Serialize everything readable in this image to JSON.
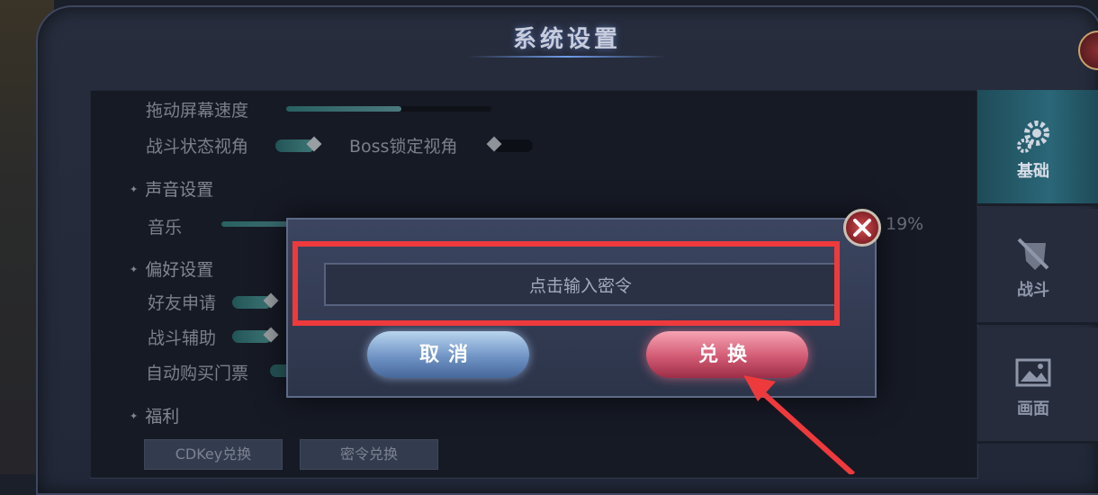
{
  "panel": {
    "title": "系统设置"
  },
  "settings": {
    "drag_speed_label": "拖动屏幕速度",
    "battle_view_label": "战斗状态视角",
    "boss_lock_label": "Boss锁定视角",
    "sound_section": "声音设置",
    "music_label": "音乐",
    "music_value": "19%",
    "music_level": 0.19,
    "pref_section": "偏好设置",
    "friend_request_label": "好友申请",
    "battle_assist_label": "战斗辅助",
    "auto_ticket_label": "自动购买门票",
    "welfare_section": "福利",
    "cdkey_button": "CDKey兑换",
    "password_button": "密令兑换"
  },
  "side_tabs": [
    {
      "label": "基础",
      "icon": "gear-icon",
      "active": true
    },
    {
      "label": "战斗",
      "icon": "sword-shield-icon",
      "active": false
    },
    {
      "label": "画面",
      "icon": "image-icon",
      "active": false
    }
  ],
  "dialog": {
    "input_placeholder": "点击输入密令",
    "cancel_label": "取消",
    "confirm_label": "兑换"
  },
  "annotation": {
    "highlight_color": "#ee3a3c",
    "arrow_color": "#ee3a3c"
  }
}
